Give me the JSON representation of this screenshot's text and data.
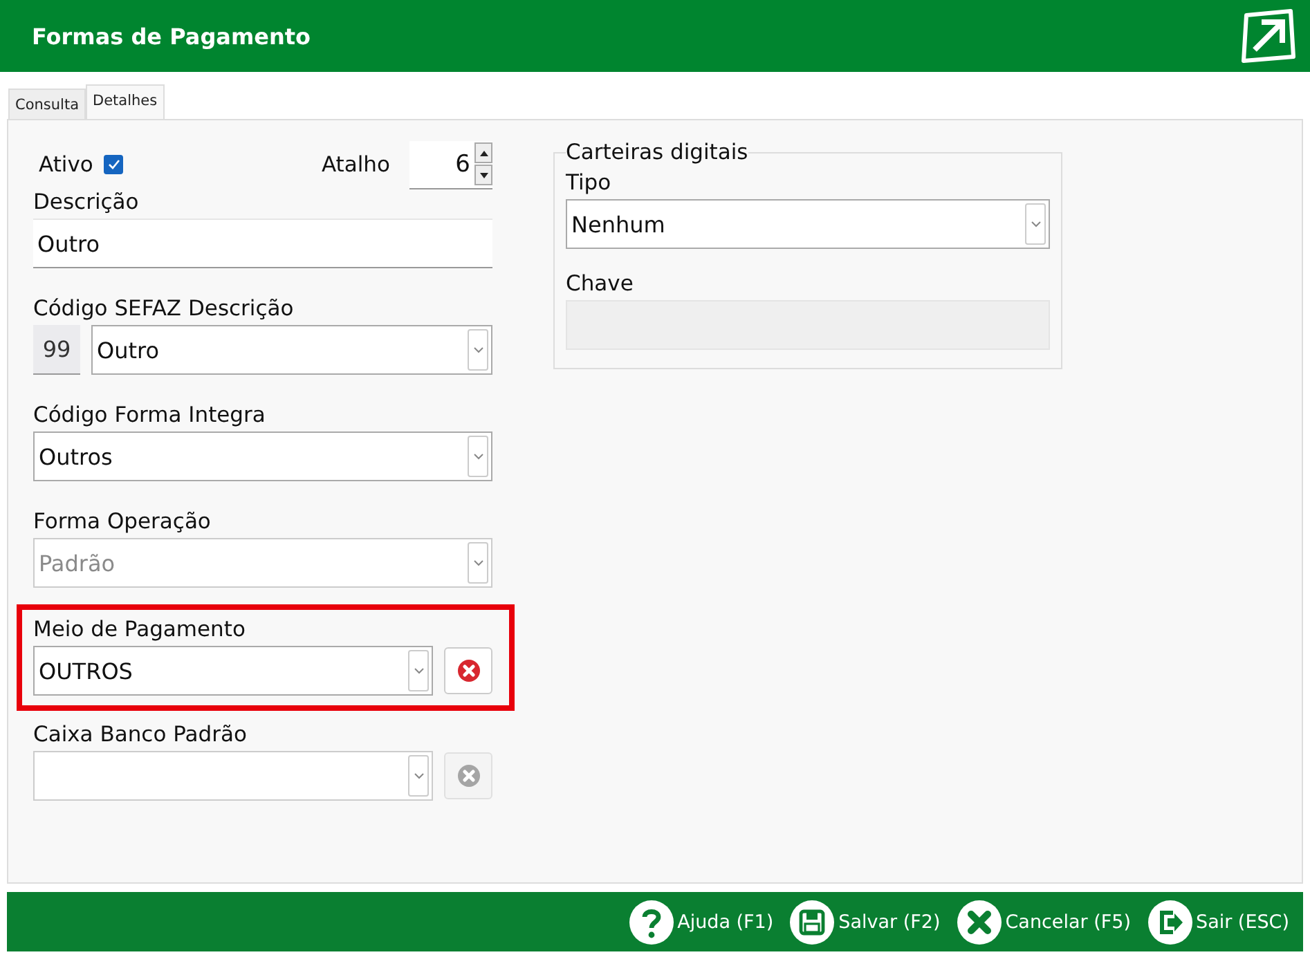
{
  "header": {
    "title": "Formas de Pagamento"
  },
  "tabs": [
    {
      "label": "Consulta",
      "selected": false
    },
    {
      "label": "Detalhes",
      "selected": true
    }
  ],
  "ativo": {
    "label": "Ativo",
    "checked": true
  },
  "atalho": {
    "label": "Atalho",
    "value": "6"
  },
  "fields": [
    {
      "kind": "text",
      "label": "Descrição",
      "value": "Outro"
    },
    {
      "kind": "coded-select",
      "label": "Código SEFAZ Descrição",
      "code": "99",
      "value": "Outro"
    },
    {
      "kind": "select",
      "label": "Código Forma Integra",
      "value": "Outros",
      "disabled": false
    },
    {
      "kind": "select",
      "label": "Forma Operação",
      "value": "Padrão",
      "disabled": true
    },
    {
      "kind": "clearable-select",
      "label": "Meio de Pagamento",
      "value": "OUTROS",
      "highlighted": true,
      "disabled": false
    },
    {
      "kind": "clearable-select",
      "label": "Caixa Banco Padrão",
      "highlighted": false,
      "disabled": true
    }
  ],
  "wallets": {
    "legend": "Carteiras digitais",
    "tipo": {
      "label": "Tipo",
      "value": "Nenhum"
    },
    "chave": {
      "label": "Chave",
      "disabled": true
    }
  },
  "footer_buttons": [
    {
      "kind": "help",
      "label": "Ajuda (F1)"
    },
    {
      "kind": "save",
      "label": "Salvar (F2)"
    },
    {
      "kind": "cancel",
      "label": "Cancelar (F5)"
    },
    {
      "kind": "exit",
      "label": "Sair (ESC)"
    }
  ]
}
